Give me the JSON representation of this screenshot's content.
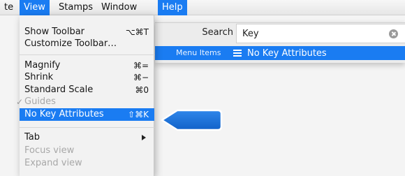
{
  "menubar": {
    "items": [
      {
        "label": "te"
      },
      {
        "label": "View"
      },
      {
        "label": "Stamps"
      },
      {
        "label": "Window"
      },
      {
        "label": "Help"
      }
    ]
  },
  "search": {
    "label": "Search",
    "value": "Key",
    "results_category": "Menu Items",
    "result_item": "No Key Attributes"
  },
  "view_menu": {
    "show_toolbar": {
      "label": "Show Toolbar",
      "shortcut": "⌥⌘T"
    },
    "customize_toolbar": {
      "label": "Customize Toolbar…"
    },
    "magnify": {
      "label": "Magnify",
      "shortcut": "⌘="
    },
    "shrink": {
      "label": "Shrink",
      "shortcut": "⌘−"
    },
    "standard_scale": {
      "label": "Standard Scale",
      "shortcut": "⌘0"
    },
    "guides": {
      "label": "Guides",
      "checked": true
    },
    "no_key_attributes": {
      "label": "No Key Attributes",
      "shortcut": "⇧⌘K"
    },
    "tab": {
      "label": "Tab"
    },
    "focus_view": {
      "label": "Focus view"
    },
    "expand_view": {
      "label": "Expand view"
    }
  },
  "colors": {
    "accent": "#1a7cf2",
    "callout": "#1a6fd8"
  }
}
